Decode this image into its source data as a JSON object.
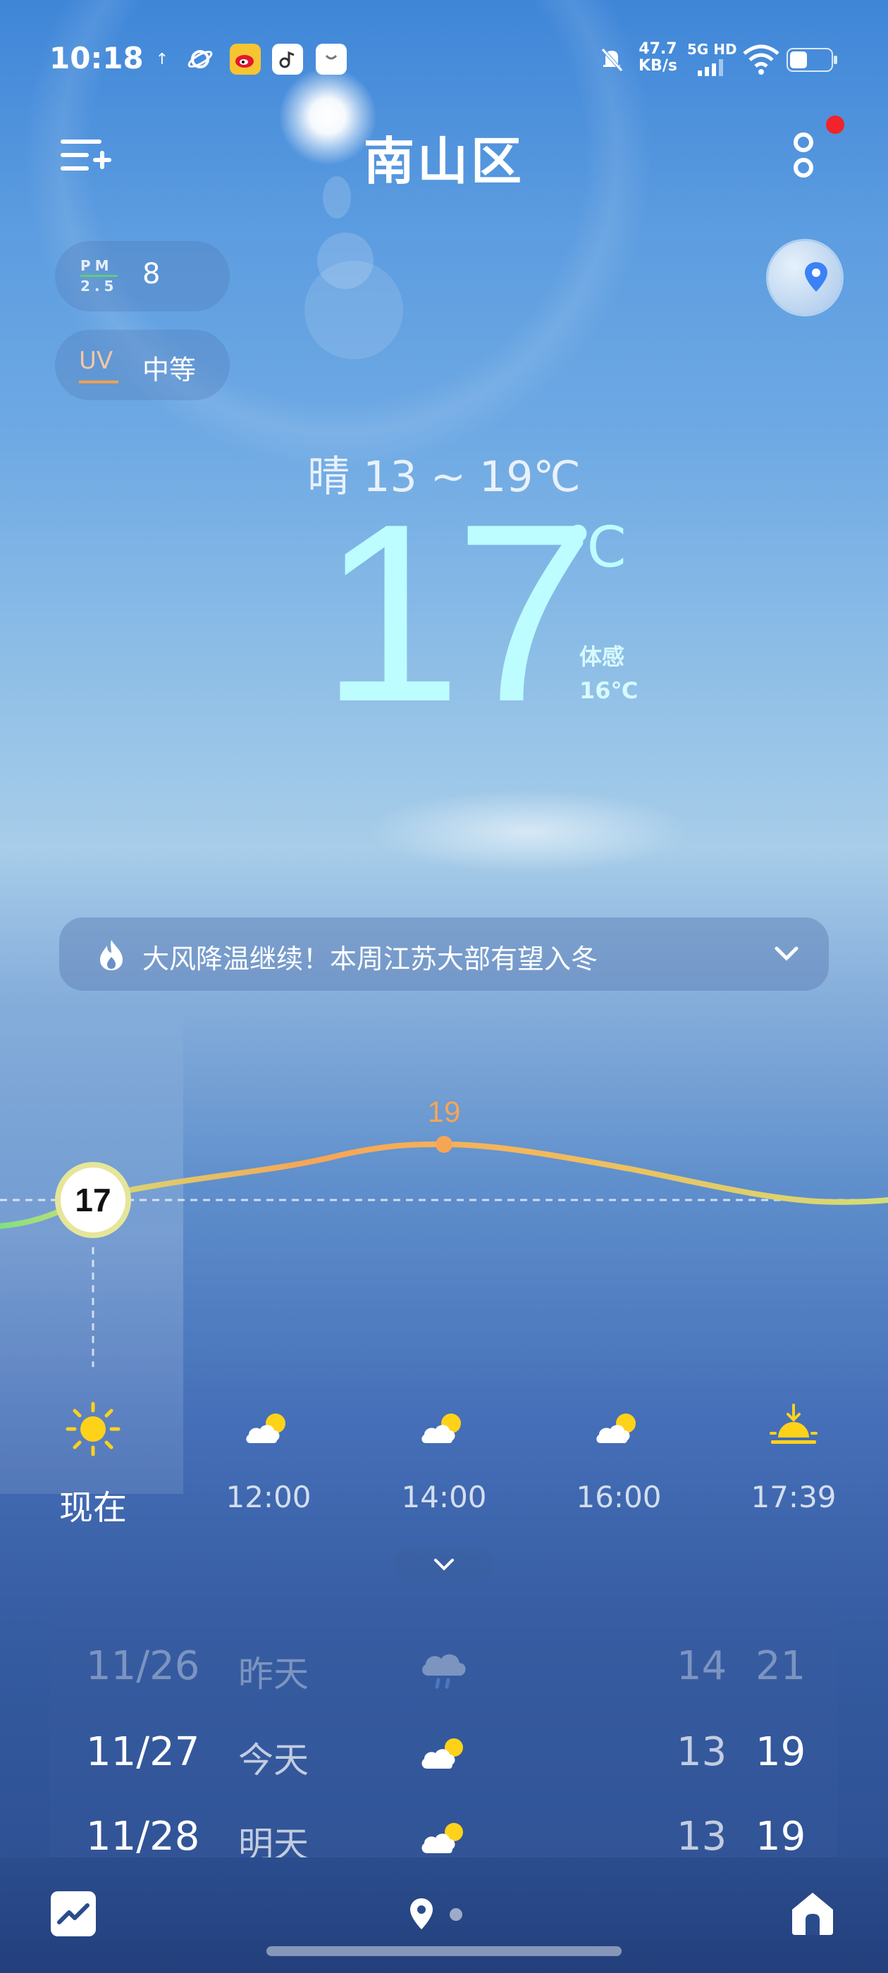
{
  "status_bar": {
    "time": "10:18",
    "net_speed_value": "47.7",
    "net_speed_unit": "KB/s",
    "network_type": "5G HD",
    "icons": [
      "upload-arrow-icon",
      "planet-icon",
      "weibo-icon",
      "music-icon",
      "shopping-bag-icon",
      "mute-bell-icon",
      "signal-icon",
      "wifi-icon",
      "battery-icon"
    ]
  },
  "header": {
    "city": "南山区"
  },
  "air": {
    "pm_label_top": "PM",
    "pm_label_bottom": "2.5",
    "pm_value": "8",
    "uv_label": "UV",
    "uv_value": "中等"
  },
  "current": {
    "summary": "晴  13 ~ 19℃",
    "temperature": "17",
    "unit": "℃",
    "feels_label": "体感",
    "feels_value": "16℃"
  },
  "news": {
    "text": "大风降温继续！本周江苏大部有望入冬"
  },
  "hourly": {
    "current_temp": "17",
    "peak_temp": "19",
    "items": [
      {
        "label": "现在",
        "icon": "sun-icon"
      },
      {
        "label": "12:00",
        "icon": "partly-cloudy-icon"
      },
      {
        "label": "14:00",
        "icon": "partly-cloudy-icon"
      },
      {
        "label": "16:00",
        "icon": "partly-cloudy-icon"
      },
      {
        "label": "17:39",
        "icon": "sunset-icon"
      }
    ]
  },
  "daily": [
    {
      "date": "11/26",
      "name": "昨天",
      "icon": "rain-cloud-icon",
      "low": "14",
      "high": "21"
    },
    {
      "date": "11/27",
      "name": "今天",
      "icon": "partly-cloudy-icon",
      "low": "13",
      "high": "19"
    },
    {
      "date": "11/28",
      "name": "明天",
      "icon": "partly-cloudy-icon",
      "low": "13",
      "high": "19"
    }
  ],
  "colors": {
    "temperature": "#bdfcff",
    "curve_warm": "#f6a556",
    "curve_cool": "#d4dd77",
    "notification_dot": "#f2232a"
  }
}
